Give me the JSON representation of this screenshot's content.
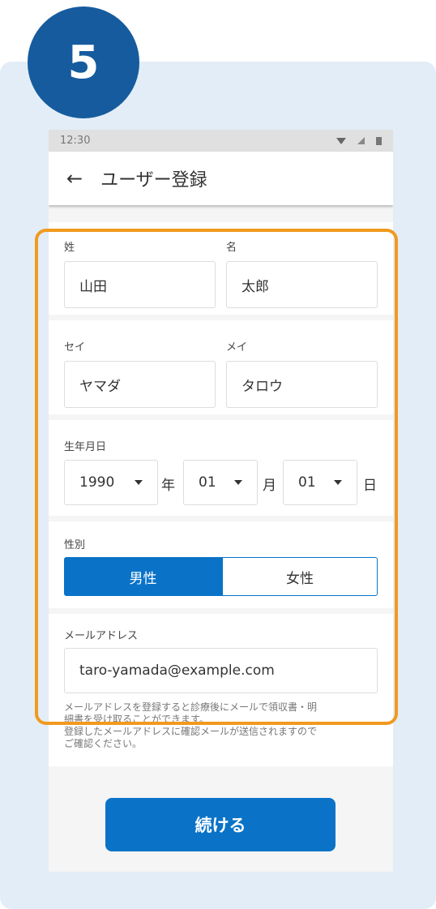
{
  "step": {
    "number": "5"
  },
  "status_bar": {
    "time": "12:30"
  },
  "app_bar": {
    "back": "←",
    "title": "ユーザー登録"
  },
  "form": {
    "last_name": {
      "label": "姓",
      "value": "山田"
    },
    "first_name": {
      "label": "名",
      "value": "太郎"
    },
    "last_name_kana": {
      "label": "セイ",
      "value": "ヤマダ"
    },
    "first_name_kana": {
      "label": "メイ",
      "value": "タロウ"
    },
    "birthdate": {
      "label": "生年月日",
      "year": "1990",
      "year_unit": "年",
      "month": "01",
      "month_unit": "月",
      "day": "01",
      "day_unit": "日"
    },
    "gender": {
      "label": "性別",
      "options": [
        "男性",
        "女性"
      ],
      "selected": "男性"
    },
    "email": {
      "label": "メールアドレス",
      "value": "taro-yamada@example.com",
      "note_line1": "メールアドレスを登録すると診療後にメールで領収書・明",
      "note_line2": "細書を受け取ることができます。",
      "note_line3": "登録したメールアドレスに確認メールが送信されますので",
      "note_line4": "ご確認ください。"
    }
  },
  "continue_button": "続ける",
  "colors": {
    "primary": "#0a73c8",
    "badge": "#165b9e",
    "highlight": "#f09a1f",
    "card": "#e3edf7"
  },
  "icons": {
    "back": "arrow-left-icon",
    "status": [
      "wifi-icon",
      "signal-icon",
      "battery-icon"
    ]
  }
}
